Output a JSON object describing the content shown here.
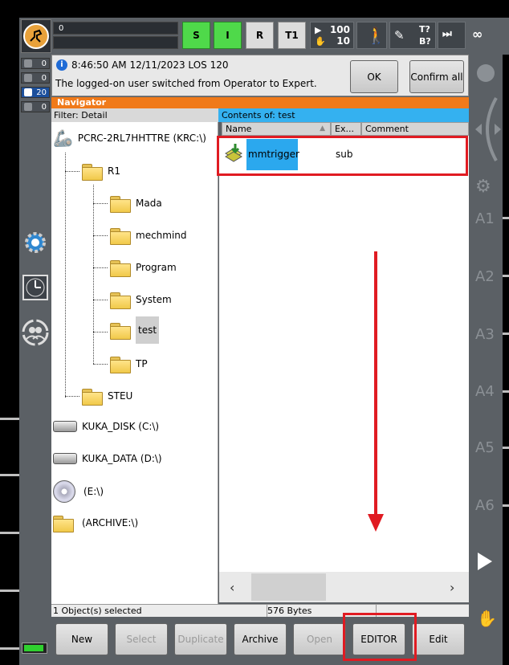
{
  "header": {
    "program_field": "0",
    "status_buttons": [
      "S",
      "I",
      "R",
      "T1"
    ],
    "override_values": [
      "100",
      "10"
    ],
    "increment_icon_labels": [
      "T?",
      "B?"
    ],
    "infinity": "∞"
  },
  "counters": [
    "0",
    "0",
    "20",
    "0"
  ],
  "message": {
    "time": "8:46:50 AM 12/11/2023 LOS 120",
    "text": "The logged-on user switched from Operator to Expert.",
    "ok_label": "OK",
    "confirm_all_label": "Confirm all"
  },
  "navigator": {
    "title": "Navigator",
    "filter": "Filter: Detail",
    "tree": {
      "root": "PCRC-2RL7HHTTRE (KRC:\\)",
      "r1": "R1",
      "children": [
        "Mada",
        "mechmind",
        "Program",
        "System",
        "test",
        "TP"
      ],
      "steu": "STEU",
      "drives": [
        "KUKA_DISK (C:\\)",
        "KUKA_DATA (D:\\)",
        "(E:\\)",
        "(ARCHIVE:\\)"
      ]
    },
    "contents_title": "Contents of: test",
    "columns": [
      "Name",
      "Ex...",
      "Comment"
    ],
    "files": [
      {
        "name": "mmtrigger",
        "ext": "sub"
      }
    ],
    "status_selected": "1 Object(s) selected",
    "status_size": "576 Bytes"
  },
  "axes": [
    "A1",
    "A2",
    "A3",
    "A4",
    "A5",
    "A6"
  ],
  "bottom_buttons": {
    "new": "New",
    "select": "Select",
    "duplicate": "Duplicate",
    "archive": "Archive",
    "open": "Open",
    "editor": "EDITOR",
    "edit": "Edit"
  },
  "colors": {
    "navigator_header": "#f07a1a",
    "contents_header": "#34b1f0",
    "selection": "#2ba8ee",
    "annotation_red": "#e01b22",
    "status_green": "#4fd94a"
  }
}
